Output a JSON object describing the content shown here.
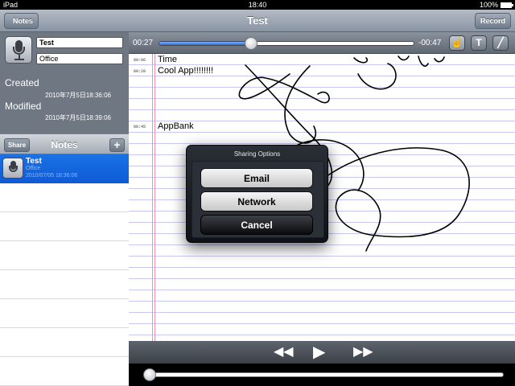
{
  "status_bar": {
    "device": "iPad",
    "time": "18:40",
    "battery": "100%",
    "battery_level": 1.0
  },
  "nav": {
    "back_label": "Notes",
    "title": "Test",
    "record_label": "Record"
  },
  "note_info": {
    "name": "Test",
    "place": "Office",
    "created_label": "Created",
    "created_value": "2010年7月5日18:36:06",
    "modified_label": "Modified",
    "modified_value": "2010年7月5日18:39:06"
  },
  "notes_bar": {
    "share_label": "Share",
    "title": "Notes",
    "add_label": "+"
  },
  "notes_list": [
    {
      "title": "Test",
      "subtitle": "Office",
      "date": "2010/07/05 18:36:06",
      "selected": true
    }
  ],
  "player": {
    "elapsed": "00:27",
    "remaining": "-00:47",
    "progress": 0.36,
    "tools": [
      {
        "name": "hand-tool-icon",
        "glyph": "☝",
        "active": true
      },
      {
        "name": "text-tool-icon",
        "glyph": "T",
        "active": false
      },
      {
        "name": "pen-tool-icon",
        "glyph": "╱",
        "active": false
      }
    ],
    "position": 0.0
  },
  "text_notes": [
    {
      "stamp": "00:06",
      "text": "Time"
    },
    {
      "stamp": "00:20",
      "text": "Cool App!!!!!!!!"
    },
    {
      "stamp": "00:45",
      "text": "AppBank"
    }
  ],
  "transport": {
    "rewind_icon": "rewind-icon",
    "play_icon": "play-icon",
    "forward_icon": "fast-forward-icon"
  },
  "sharing_popover": {
    "title": "Sharing Options",
    "email_label": "Email",
    "network_label": "Network",
    "cancel_label": "Cancel"
  },
  "colors": {
    "accent_blue": "#1a72e6",
    "margin_pink": "#e98fbb",
    "rule_blue": "#c7c9ee"
  }
}
